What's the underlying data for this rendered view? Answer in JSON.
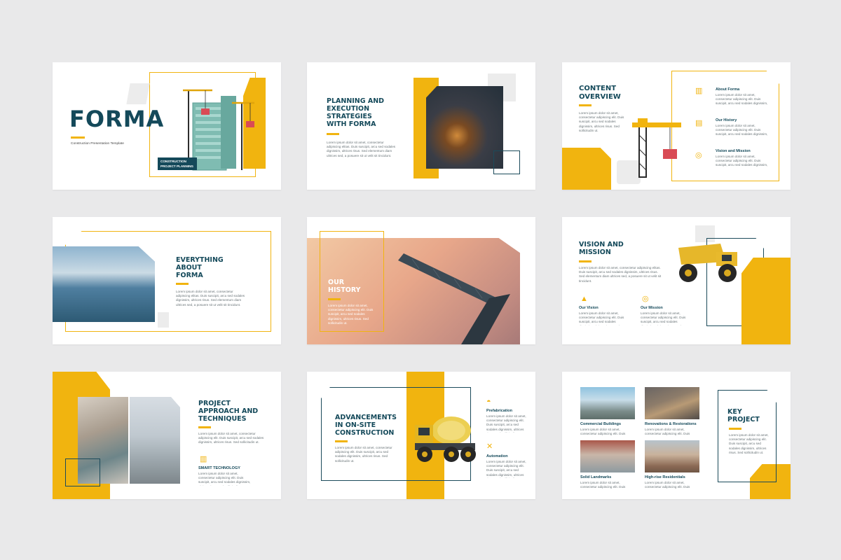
{
  "lorem": "Lorem ipsum dolor sit amet, consectetur adipiscing elitas. Duis suscipit, arcu sed sodales dignissim, ultrices risus. Sed elementum diam ultrices sed, a posuere sit ut velit sit tincidunt.",
  "lorem_short": "Lorem ipsum dolor sit amet, consectetur adipiscing elit. Duis suscipit, arcu sed sodales dignissim, ultrices risus. Sed sollicitudin ut.",
  "colors": {
    "accent": "#f1b40f",
    "primary": "#14495a",
    "background": "#e9e9ea"
  },
  "slides": {
    "s1": {
      "title": "FORMA",
      "subtitle": "Construction Presentation Template",
      "badge_line1": "CONSTRUCTION",
      "badge_line2": "PROJECT PLANNING"
    },
    "s2": {
      "title": "PLANNING AND EXECUTION STRATEGIES WITH FORMA"
    },
    "s3": {
      "title": "CONTENT OVERVIEW",
      "items": [
        "About Forma",
        "Our History",
        "Vision and Mission"
      ]
    },
    "s4": {
      "title": "EVERYTHING ABOUT FORMA"
    },
    "s5": {
      "title": "OUR HISTORY"
    },
    "s6": {
      "title": "VISION AND MISSION",
      "items": [
        "Our Vision",
        "Our Mission"
      ]
    },
    "s7": {
      "title": "PROJECT APPROACH AND TECHNIQUES",
      "item": "SMART TECHNOLOGY"
    },
    "s8": {
      "title": "ADVANCEMENTS IN ON-SITE CONSTRUCTION",
      "items": [
        "Prefabrication",
        "Automation"
      ]
    },
    "s9": {
      "title": "KEY PROJECT",
      "items": [
        "Commercial Buildings",
        "Renovations & Restorations",
        "Solid Landmarks",
        "High-rise Residentials"
      ]
    }
  }
}
